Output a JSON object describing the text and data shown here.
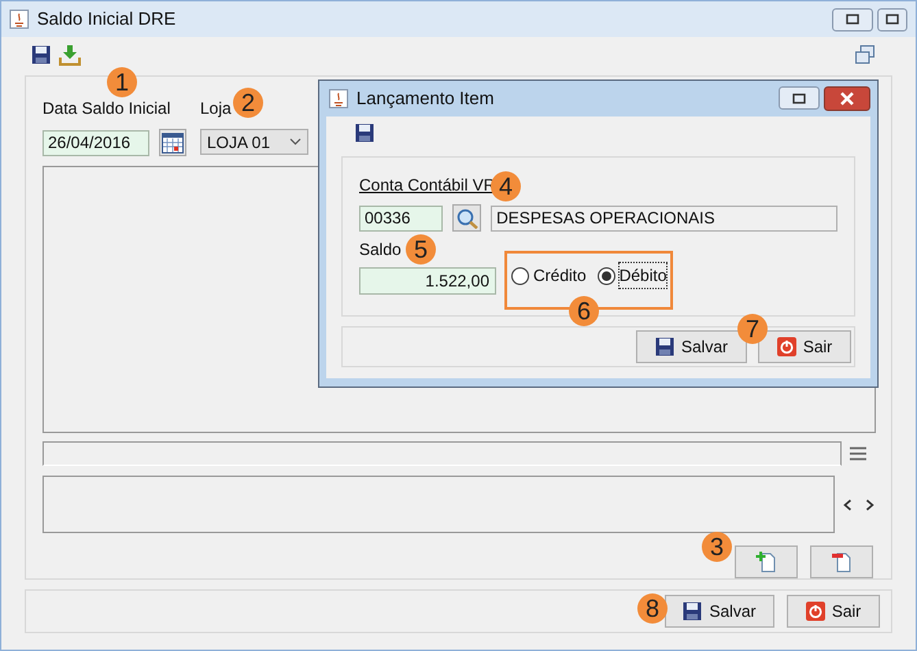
{
  "window": {
    "title": "Saldo Inicial DRE"
  },
  "form": {
    "date_label": "Data Saldo Inicial",
    "date_value": "26/04/2016",
    "store_label": "Loja",
    "store_value": "LOJA 01"
  },
  "footer_buttons": [
    {
      "label": "Salvar",
      "kind": "save"
    },
    {
      "label": "Sair",
      "kind": "exit"
    }
  ],
  "dialog": {
    "title": "Lançamento Item",
    "account_label": "Conta Contábil VR",
    "account_code": "00336",
    "account_name": "DESPESAS OPERACIONAIS",
    "balance_label": "Saldo",
    "balance_value": "1.522,00",
    "options": [
      {
        "label": "Crédito",
        "selected": false
      },
      {
        "label": "Débito",
        "selected": true
      }
    ],
    "buttons": [
      {
        "label": "Salvar",
        "kind": "save"
      },
      {
        "label": "Sair",
        "kind": "exit"
      }
    ]
  },
  "callouts": [
    "1",
    "2",
    "3",
    "4",
    "5",
    "6",
    "7",
    "8"
  ]
}
